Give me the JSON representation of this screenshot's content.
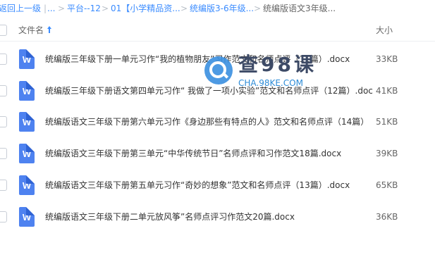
{
  "breadcrumb": {
    "items": [
      "返回上一级",
      "|",
      "...",
      ">",
      "平台--12",
      ">",
      "01【小学精品资...",
      ">",
      "统编版3-6年级...",
      ">",
      "统编版语文3年级..."
    ]
  },
  "header": {
    "name_label": "文件名",
    "size_label": "大小",
    "sort_icon": "arrow-up-icon"
  },
  "files": [
    {
      "name": "统编版三年级下册一单元习作“我的植物朋友”习作范文和名师点评（11篇）.docx",
      "size": "33KB",
      "icon": "word-doc-icon",
      "icon_letter": "W"
    },
    {
      "name": "统编版三年级下册语文第四单元习作“ 我做了一项小实验”范文和名师点评（12篇）.doc",
      "size": "41KB",
      "icon": "word-doc-icon",
      "icon_letter": "W"
    },
    {
      "name": "统编版语文三年级下册第六单元习作《身边那些有特点的人》范文和名师点评（14篇）",
      "size": "51KB",
      "icon": "word-doc-icon",
      "icon_letter": "W"
    },
    {
      "name": "统编版语文三年级下册第三单元“中华传统节日”名师点评和习作范文18篇.docx",
      "size": "39KB",
      "icon": "word-doc-icon",
      "icon_letter": "W"
    },
    {
      "name": "统编版语文三年级下册第五单元习作“奇妙的想象”范文和名师点评（13篇）.docx",
      "size": "65KB",
      "icon": "word-doc-icon",
      "icon_letter": "W"
    },
    {
      "name": "统编版语文三年级下册二单元放风筝”名师点评习作范文20篇.docx",
      "size": "36KB",
      "icon": "word-doc-icon",
      "icon_letter": "W"
    }
  ],
  "watermark": {
    "brand": "查98课",
    "domain": "CHA.98KE.COM",
    "icon": "search-logo-icon"
  },
  "colors": {
    "link": "#3b8cff",
    "doc_icon": "#4e82f0",
    "text": "#333333",
    "muted": "#666666"
  }
}
